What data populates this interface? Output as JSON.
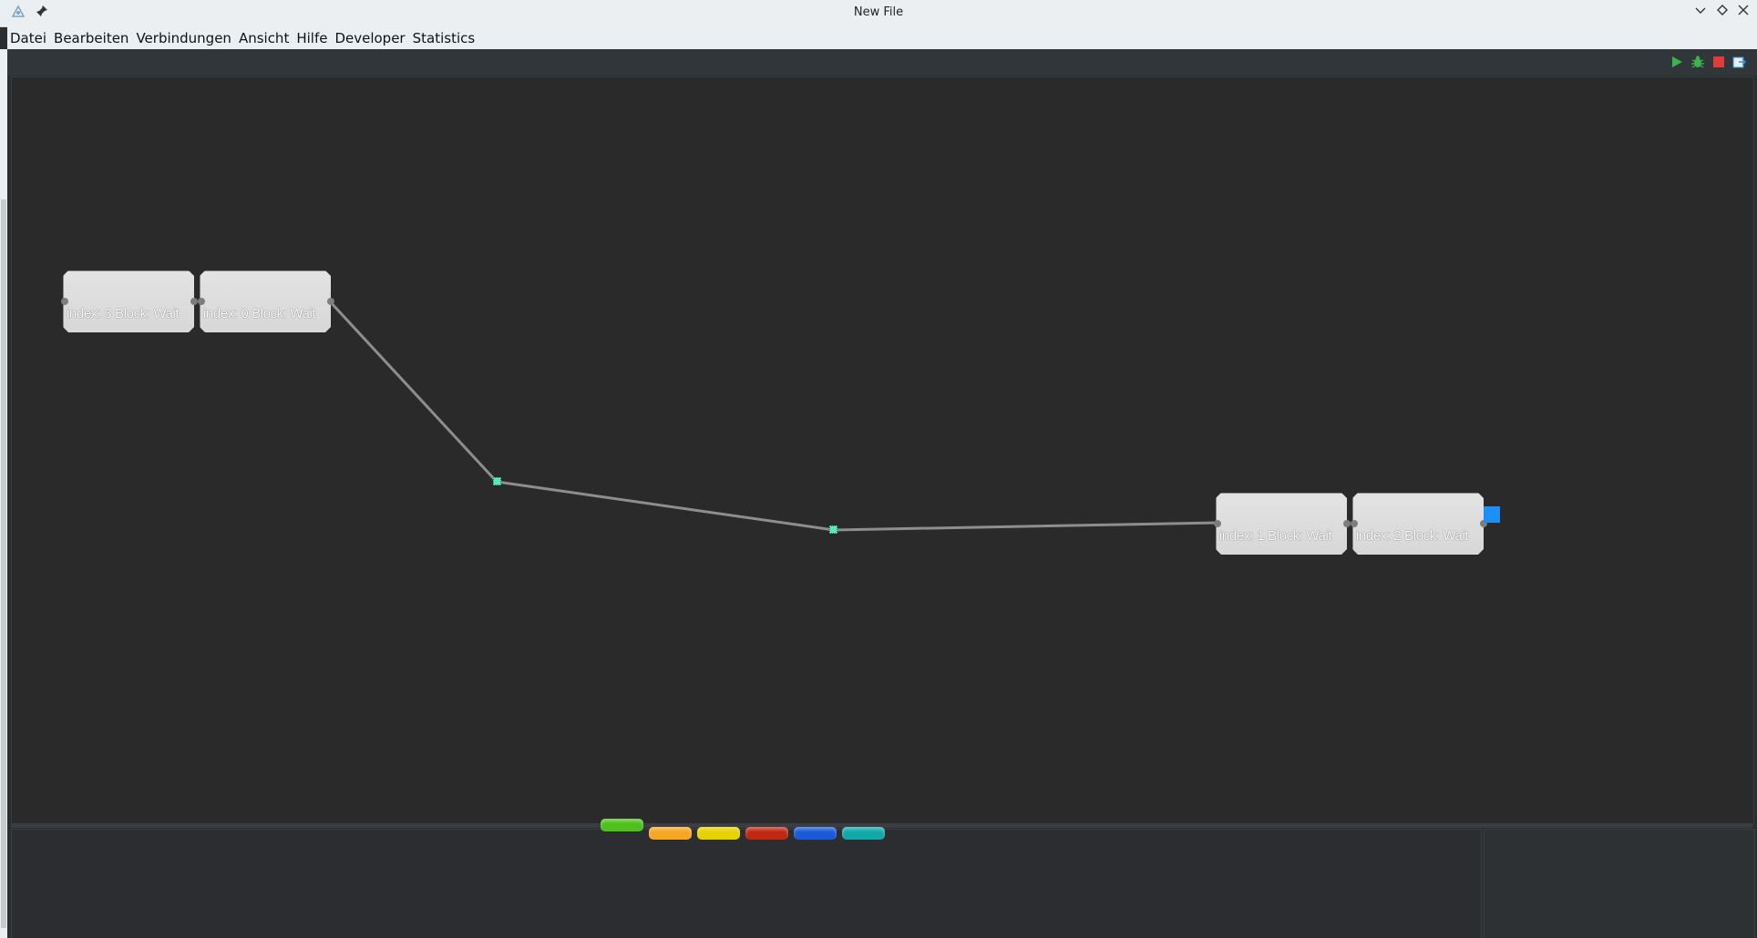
{
  "window": {
    "title": "New File"
  },
  "menu": [
    "Datei",
    "Bearbeiten",
    "Verbindungen",
    "Ansicht",
    "Hilfe",
    "Developer",
    "Statistics"
  ],
  "toolbar": {
    "run_color": "#3bb54a",
    "debug_color": "#3bb54a",
    "stop_color": "#e03a3a",
    "export_color": "#2f8fd8"
  },
  "blocks": [
    {
      "label": "index:  3 Block: Wait"
    },
    {
      "label": "index:  0 Block: Wait"
    },
    {
      "label": "index:  1 Block: Wait"
    },
    {
      "label": "index:  2 Block: Wait"
    }
  ],
  "palette_tabs": [
    {
      "name": "green",
      "color": "#4cc21a"
    },
    {
      "name": "orange",
      "color": "#f5a623"
    },
    {
      "name": "yellow",
      "color": "#e6d200"
    },
    {
      "name": "red",
      "color": "#c02810"
    },
    {
      "name": "blue",
      "color": "#1a5ad8"
    },
    {
      "name": "teal",
      "color": "#12a8a8"
    }
  ]
}
